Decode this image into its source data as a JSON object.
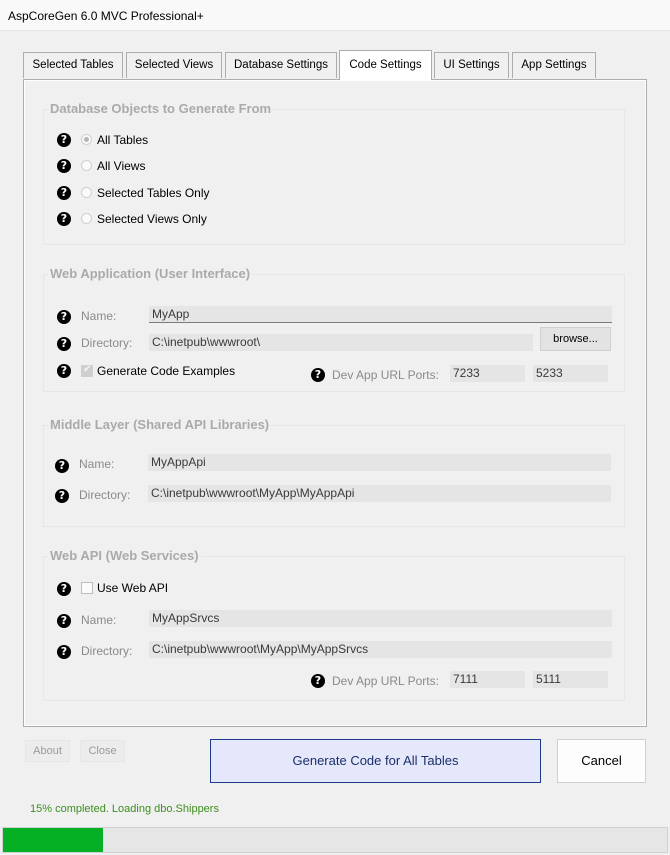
{
  "window": {
    "title": "AspCoreGen 6.0 MVC Professional+"
  },
  "tabs": [
    {
      "label": "Selected Tables"
    },
    {
      "label": "Selected Views"
    },
    {
      "label": "Database Settings"
    },
    {
      "label": "Code Settings",
      "active": true
    },
    {
      "label": "UI Settings"
    },
    {
      "label": "App Settings"
    }
  ],
  "db_objects": {
    "title": "Database Objects to Generate From",
    "options": [
      {
        "label": "All Tables",
        "checked": true
      },
      {
        "label": "All Views",
        "checked": false
      },
      {
        "label": "Selected Tables Only",
        "checked": false
      },
      {
        "label": "Selected Views Only",
        "checked": false
      }
    ]
  },
  "web_app": {
    "title": "Web Application (User Interface)",
    "name_label": "Name:",
    "name_value": "MyApp",
    "dir_label": "Directory:",
    "dir_value": "C:\\inetpub\\wwwroot\\",
    "browse_label": "browse...",
    "gen_examples_label": "Generate Code Examples",
    "gen_examples_checked": true,
    "ports_label": "Dev App URL Ports:",
    "port1": "7233",
    "port2": "5233"
  },
  "middle": {
    "title": "Middle Layer (Shared API Libraries)",
    "name_label": "Name:",
    "name_value": "MyAppApi",
    "dir_label": "Directory:",
    "dir_value": "C:\\inetpub\\wwwroot\\MyApp\\MyAppApi"
  },
  "web_api": {
    "title": "Web API (Web Services)",
    "use_label": "Use Web API",
    "use_checked": false,
    "name_label": "Name:",
    "name_value": "MyAppSrvcs",
    "dir_label": "Directory:",
    "dir_value": "C:\\inetpub\\wwwroot\\MyApp\\MyAppSrvcs",
    "ports_label": "Dev App URL Ports:",
    "port1": "7111",
    "port2": "5111"
  },
  "footer": {
    "about_label": "About",
    "close_label": "Close",
    "generate_label": "Generate Code for All Tables",
    "cancel_label": "Cancel",
    "status_text": "15% completed.  Loading dbo.Shippers",
    "progress": 0.15
  },
  "colors": {
    "accent": "#1e3a8a",
    "progress": "#06b025",
    "status": "#3c8f1e"
  }
}
